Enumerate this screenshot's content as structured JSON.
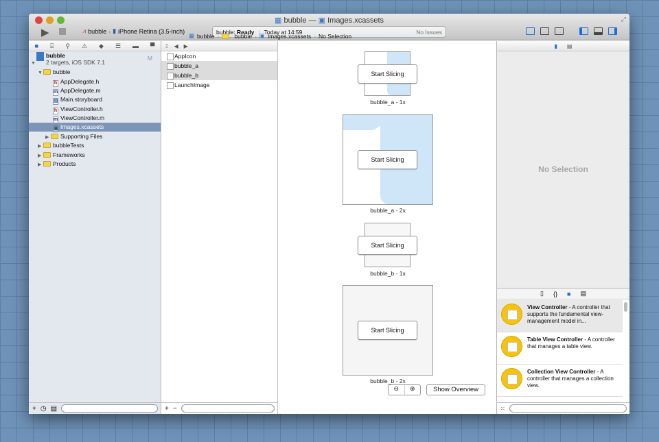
{
  "window": {
    "title_project": "bubble",
    "title_sep": "—",
    "title_file": "Images.xcassets"
  },
  "toolbar": {
    "scheme": "bubble",
    "device": "iPhone Retina (3.5-inch)",
    "status_project": "bubble:",
    "status_state": "Ready",
    "status_time": "Today at 14:59",
    "issues": "No Issues"
  },
  "jumpbar": {
    "items": [
      "bubble",
      "bubble",
      "Images.xcassets",
      "No Selection"
    ]
  },
  "navigator": {
    "project": "bubble",
    "project_sub": "2 targets, iOS SDK 7.1",
    "badge": "M",
    "items": [
      {
        "label": "bubble",
        "type": "folder"
      },
      {
        "label": "AppDelegate.h",
        "type": "h"
      },
      {
        "label": "AppDelegate.m",
        "type": "m"
      },
      {
        "label": "Main.storyboard",
        "type": "sb"
      },
      {
        "label": "ViewController.h",
        "type": "h"
      },
      {
        "label": "ViewController.m",
        "type": "m"
      },
      {
        "label": "Images.xcassets",
        "type": "assets"
      },
      {
        "label": "Supporting Files",
        "type": "folder"
      },
      {
        "label": "bubbleTests",
        "type": "folder"
      },
      {
        "label": "Frameworks",
        "type": "folder"
      },
      {
        "label": "Products",
        "type": "folder"
      }
    ]
  },
  "image_sets": [
    "AppIcon",
    "bubble_a",
    "bubble_b",
    "LaunchImage"
  ],
  "canvas": {
    "slices": [
      {
        "label": "bubble_a - 1x",
        "button": "Start Slicing"
      },
      {
        "label": "bubble_a - 2x",
        "button": "Start Slicing"
      },
      {
        "label": "bubble_b - 1x",
        "button": "Start Slicing"
      },
      {
        "label": "bubble_b - 2x",
        "button": "Start Slicing"
      }
    ],
    "show_overview": "Show Overview"
  },
  "inspector": {
    "empty": "No Selection"
  },
  "library": [
    {
      "title": "View Controller",
      "desc": " - A controller that supports the fundamental view-management model in..."
    },
    {
      "title": "Table View Controller",
      "desc": " - A controller that manages a table view."
    },
    {
      "title": "Collection View Controller",
      "desc": " - A controller that manages a collection view."
    }
  ],
  "colors": {
    "selection": "#7d95b8",
    "accent": "#1a6fd6",
    "bubble_fill": "#cfe5f8"
  }
}
